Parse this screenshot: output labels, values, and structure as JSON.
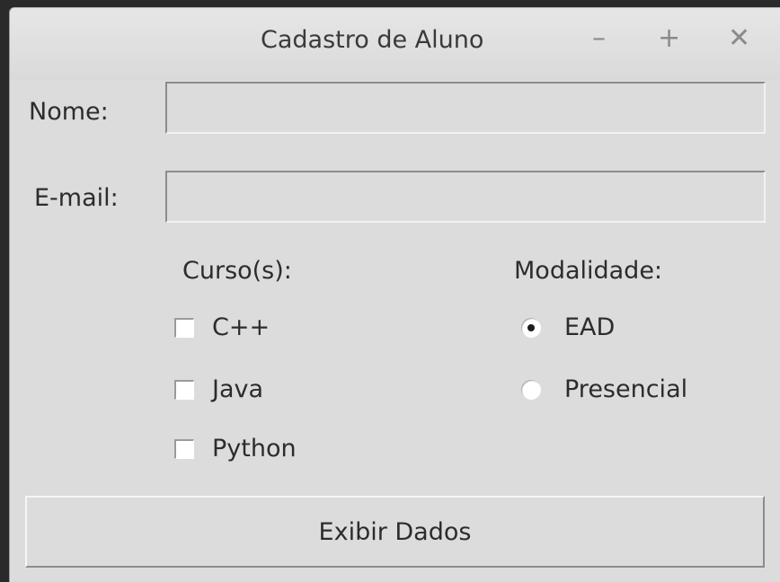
{
  "window": {
    "title": "Cadastro de Aluno",
    "minimize_glyph": "–",
    "maximize_glyph": "+",
    "close_glyph": "✕"
  },
  "form": {
    "name_label": "Nome:",
    "name_value": "",
    "email_label": "E-mail:",
    "email_value": "",
    "courses_label": "Curso(s):",
    "courses": [
      {
        "label": "C++",
        "checked": false
      },
      {
        "label": "Java",
        "checked": false
      },
      {
        "label": "Python",
        "checked": false
      }
    ],
    "modality_label": "Modalidade:",
    "modalities": [
      {
        "label": "EAD",
        "selected": true
      },
      {
        "label": "Presencial",
        "selected": false
      }
    ],
    "submit_label": "Exibir Dados"
  }
}
